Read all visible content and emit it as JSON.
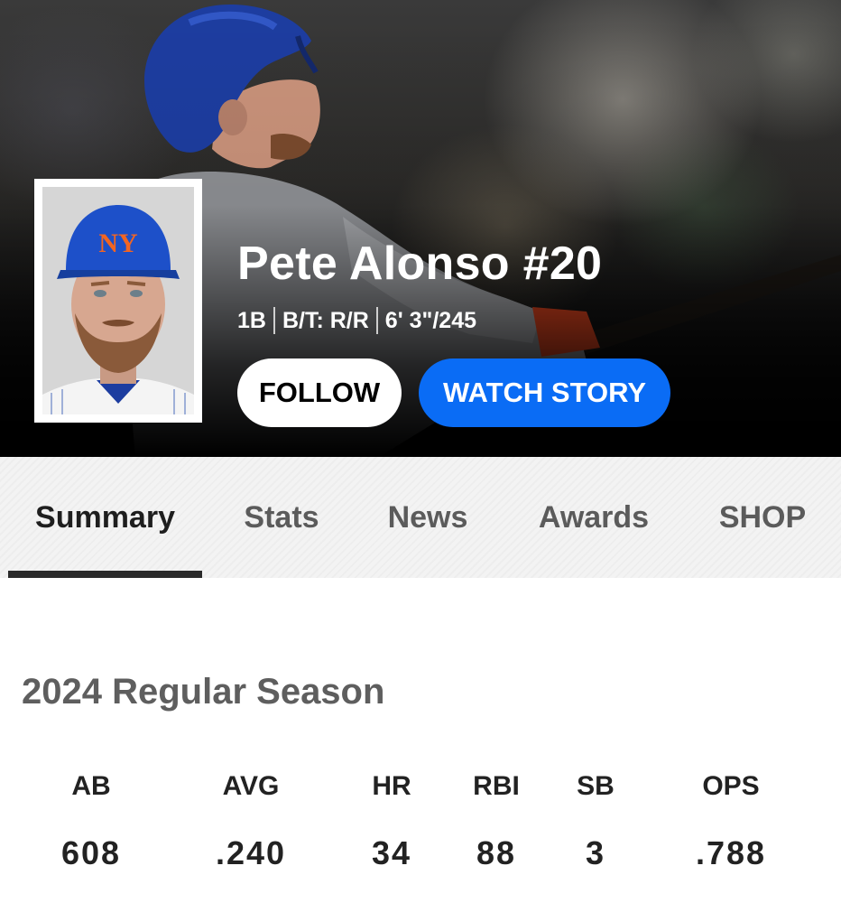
{
  "player": {
    "name": "Pete Alonso #20",
    "position": "1B",
    "bats_throws": "B/T: R/R",
    "height_weight": "6' 3\"/245"
  },
  "actions": {
    "follow_label": "FOLLOW",
    "watch_label": "WATCH STORY"
  },
  "tabs": [
    {
      "label": "Summary",
      "active": true
    },
    {
      "label": "Stats",
      "active": false
    },
    {
      "label": "News",
      "active": false
    },
    {
      "label": "Awards",
      "active": false
    },
    {
      "label": "SHOP",
      "active": false
    }
  ],
  "season": {
    "title": "2024 Regular Season",
    "stats": [
      {
        "label": "AB",
        "value": "608"
      },
      {
        "label": "AVG",
        "value": ".240"
      },
      {
        "label": "HR",
        "value": "34"
      },
      {
        "label": "RBI",
        "value": "88"
      },
      {
        "label": "SB",
        "value": "3"
      },
      {
        "label": "OPS",
        "value": ".788"
      }
    ]
  },
  "colors": {
    "accent": "#0a6cf5",
    "tab_active": "#1e1e1e",
    "tab_inactive": "#5b5b5b"
  }
}
